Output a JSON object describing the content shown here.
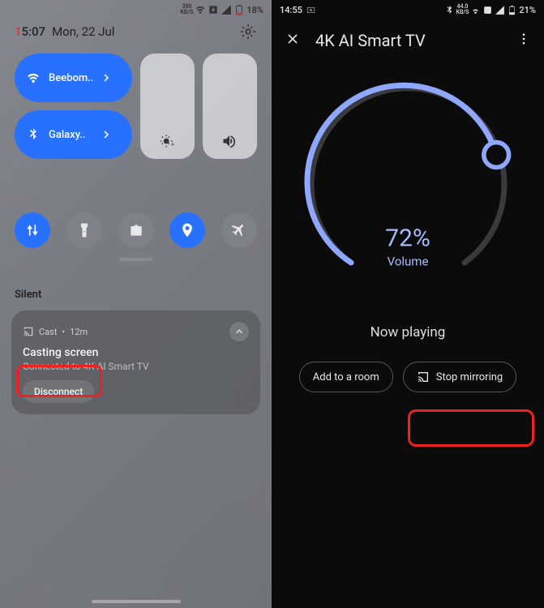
{
  "left": {
    "status": {
      "speed_top": "380",
      "speed_unit": "KB/S",
      "battery": "18%"
    },
    "time": {
      "hours_accent": "1",
      "hours_rest": "5:07",
      "date": "Mon, 22 Jul"
    },
    "tiles": {
      "wifi": "Beebom..",
      "bluetooth": "Galaxy.."
    },
    "notif_section": "Silent",
    "notif": {
      "app": "Cast",
      "sep": "•",
      "age": "12m",
      "title": "Casting screen",
      "sub": "Connected to 4K AI Smart TV",
      "action": "Disconnect"
    }
  },
  "right": {
    "status": {
      "time": "14:55",
      "speed_top": "44.0",
      "speed_unit": "KB/S",
      "battery": "21%"
    },
    "title": "4K AI Smart TV",
    "volume_pct": "72%",
    "volume_label": "Volume",
    "now_playing": "Now playing",
    "add_room": "Add to a room",
    "stop_mirror": "Stop mirroring"
  }
}
